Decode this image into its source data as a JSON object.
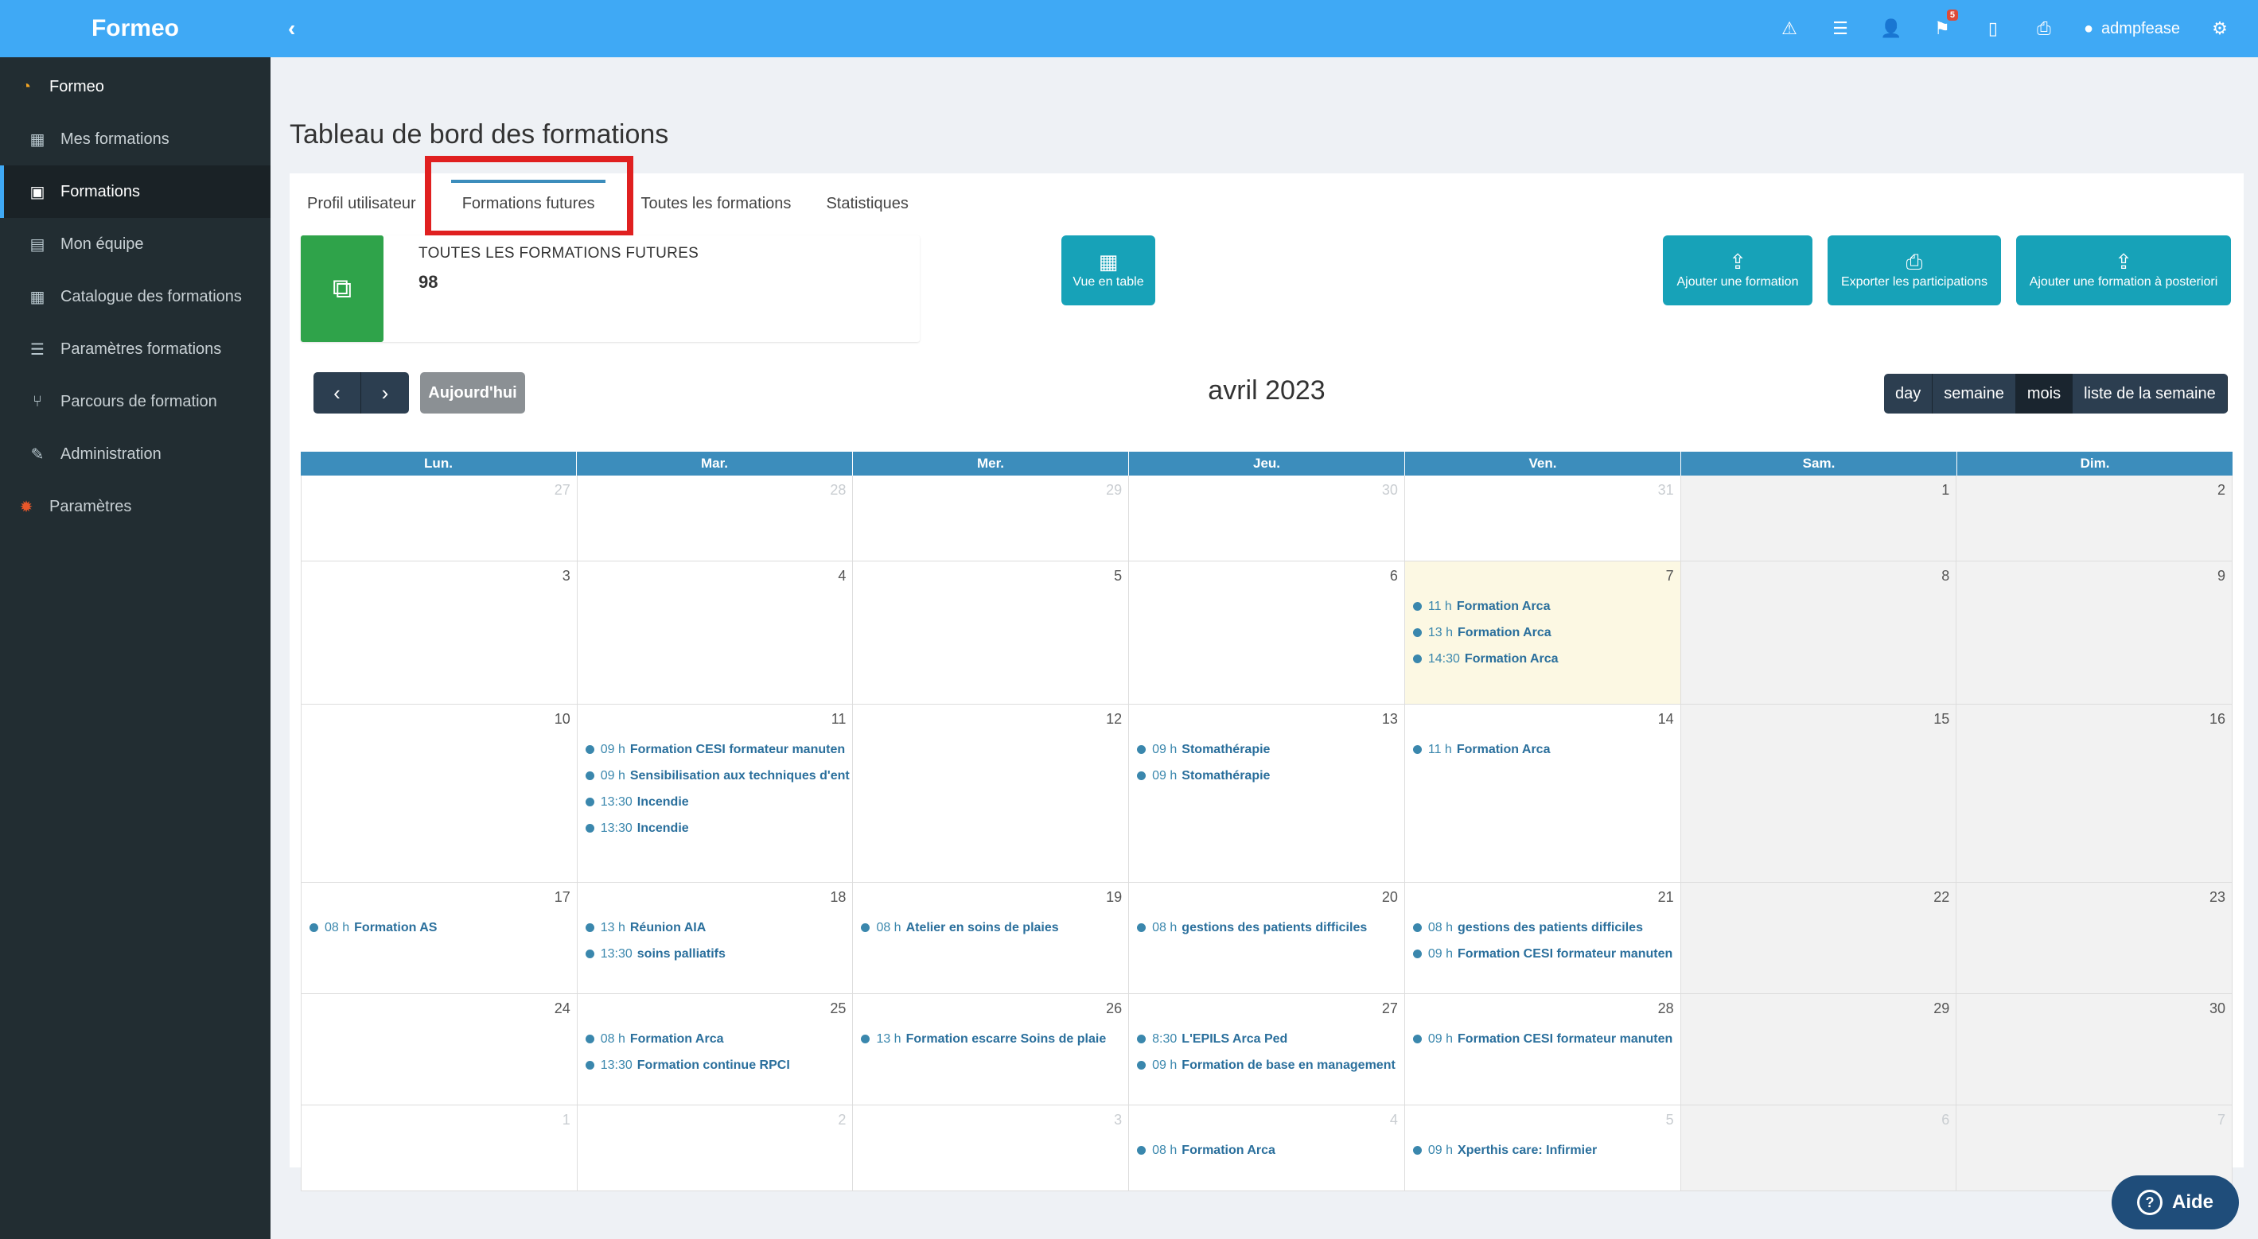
{
  "app": {
    "brand": "Formeo"
  },
  "sidebar": {
    "items": [
      {
        "label": "Formeo",
        "icon": "formeo-logo-icon"
      },
      {
        "label": "Mes formations",
        "icon": "calendar-icon"
      },
      {
        "label": "Formations",
        "icon": "calendar-check-icon"
      },
      {
        "label": "Mon équipe",
        "icon": "id-card-icon"
      },
      {
        "label": "Catalogue des formations",
        "icon": "calendar-icon"
      },
      {
        "label": "Paramètres formations",
        "icon": "sliders-icon"
      },
      {
        "label": "Parcours de formation",
        "icon": "branch-icon"
      },
      {
        "label": "Administration",
        "icon": "wrench-icon"
      },
      {
        "label": "Paramètres",
        "icon": "gear-icon"
      }
    ]
  },
  "topbar": {
    "notification_count": "5",
    "username": "admpfease"
  },
  "page": {
    "title": "Tableau de bord des formations"
  },
  "tabs": [
    {
      "label": "Profil utilisateur"
    },
    {
      "label": "Formations futures"
    },
    {
      "label": "Toutes les formations"
    },
    {
      "label": "Statistiques"
    }
  ],
  "info_box": {
    "label": "TOUTES LES FORMATIONS FUTURES",
    "value": "98"
  },
  "actions": {
    "table_view": "Vue en table",
    "add_training": "Ajouter une formation",
    "export": "Exporter les participations",
    "add_posteriori": "Ajouter une formation à posteriori"
  },
  "calendar": {
    "today_label": "Aujourd'hui",
    "title": "avril 2023",
    "views": [
      "day",
      "semaine",
      "mois",
      "liste de la semaine"
    ],
    "weekdays": [
      "Lun.",
      "Mar.",
      "Mer.",
      "Jeu.",
      "Ven.",
      "Sam.",
      "Dim."
    ],
    "weeks": [
      {
        "days": [
          {
            "num": "27",
            "other": true,
            "events": []
          },
          {
            "num": "28",
            "other": true,
            "events": []
          },
          {
            "num": "29",
            "other": true,
            "events": []
          },
          {
            "num": "30",
            "other": true,
            "events": []
          },
          {
            "num": "31",
            "other": true,
            "events": []
          },
          {
            "num": "1",
            "events": []
          },
          {
            "num": "2",
            "events": []
          }
        ]
      },
      {
        "days": [
          {
            "num": "3",
            "events": []
          },
          {
            "num": "4",
            "events": []
          },
          {
            "num": "5",
            "events": []
          },
          {
            "num": "6",
            "events": []
          },
          {
            "num": "7",
            "today": true,
            "events": [
              {
                "time": "11 h",
                "title": "Formation Arca"
              },
              {
                "time": "13 h",
                "title": "Formation Arca"
              },
              {
                "time": "14:30",
                "title": "Formation Arca"
              }
            ]
          },
          {
            "num": "8",
            "events": []
          },
          {
            "num": "9",
            "events": []
          }
        ]
      },
      {
        "days": [
          {
            "num": "10",
            "events": []
          },
          {
            "num": "11",
            "events": [
              {
                "time": "09 h",
                "title": "Formation CESI formateur manuten"
              },
              {
                "time": "09 h",
                "title": "Sensibilisation aux techniques d'ent"
              },
              {
                "time": "13:30",
                "title": "Incendie"
              },
              {
                "time": "13:30",
                "title": "Incendie"
              }
            ]
          },
          {
            "num": "12",
            "events": []
          },
          {
            "num": "13",
            "events": [
              {
                "time": "09 h",
                "title": "Stomathérapie"
              },
              {
                "time": "09 h",
                "title": "Stomathérapie"
              }
            ]
          },
          {
            "num": "14",
            "events": [
              {
                "time": "11 h",
                "title": "Formation Arca"
              }
            ]
          },
          {
            "num": "15",
            "events": []
          },
          {
            "num": "16",
            "events": []
          }
        ]
      },
      {
        "days": [
          {
            "num": "17",
            "events": [
              {
                "time": "08 h",
                "title": "Formation AS"
              }
            ]
          },
          {
            "num": "18",
            "events": [
              {
                "time": "13 h",
                "title": "Réunion AIA"
              },
              {
                "time": "13:30",
                "title": "soins palliatifs"
              }
            ]
          },
          {
            "num": "19",
            "events": [
              {
                "time": "08 h",
                "title": "Atelier en soins de plaies"
              }
            ]
          },
          {
            "num": "20",
            "events": [
              {
                "time": "08 h",
                "title": "gestions des patients difficiles"
              }
            ]
          },
          {
            "num": "21",
            "events": [
              {
                "time": "08 h",
                "title": "gestions des patients difficiles"
              },
              {
                "time": "09 h",
                "title": "Formation CESI formateur manuten"
              }
            ]
          },
          {
            "num": "22",
            "events": []
          },
          {
            "num": "23",
            "events": []
          }
        ]
      },
      {
        "days": [
          {
            "num": "24",
            "events": []
          },
          {
            "num": "25",
            "events": [
              {
                "time": "08 h",
                "title": "Formation Arca"
              },
              {
                "time": "13:30",
                "title": "Formation continue RPCI"
              }
            ]
          },
          {
            "num": "26",
            "events": [
              {
                "time": "13 h",
                "title": "Formation escarre Soins de plaie"
              }
            ]
          },
          {
            "num": "27",
            "events": [
              {
                "time": "8:30",
                "title": "L'EPILS Arca Ped"
              },
              {
                "time": "09 h",
                "title": "Formation de base en management"
              }
            ]
          },
          {
            "num": "28",
            "events": [
              {
                "time": "09 h",
                "title": "Formation CESI formateur manuten"
              }
            ]
          },
          {
            "num": "29",
            "events": []
          },
          {
            "num": "30",
            "events": []
          }
        ]
      },
      {
        "days": [
          {
            "num": "1",
            "other": true,
            "events": []
          },
          {
            "num": "2",
            "other": true,
            "events": []
          },
          {
            "num": "3",
            "other": true,
            "events": []
          },
          {
            "num": "4",
            "other": true,
            "events": [
              {
                "time": "08 h",
                "title": "Formation Arca"
              }
            ]
          },
          {
            "num": "5",
            "other": true,
            "events": [
              {
                "time": "09 h",
                "title": "Xperthis care: Infirmier"
              }
            ]
          },
          {
            "num": "6",
            "other": true,
            "events": []
          },
          {
            "num": "7",
            "other": true,
            "events": []
          }
        ]
      }
    ]
  },
  "help": {
    "label": "Aide"
  }
}
